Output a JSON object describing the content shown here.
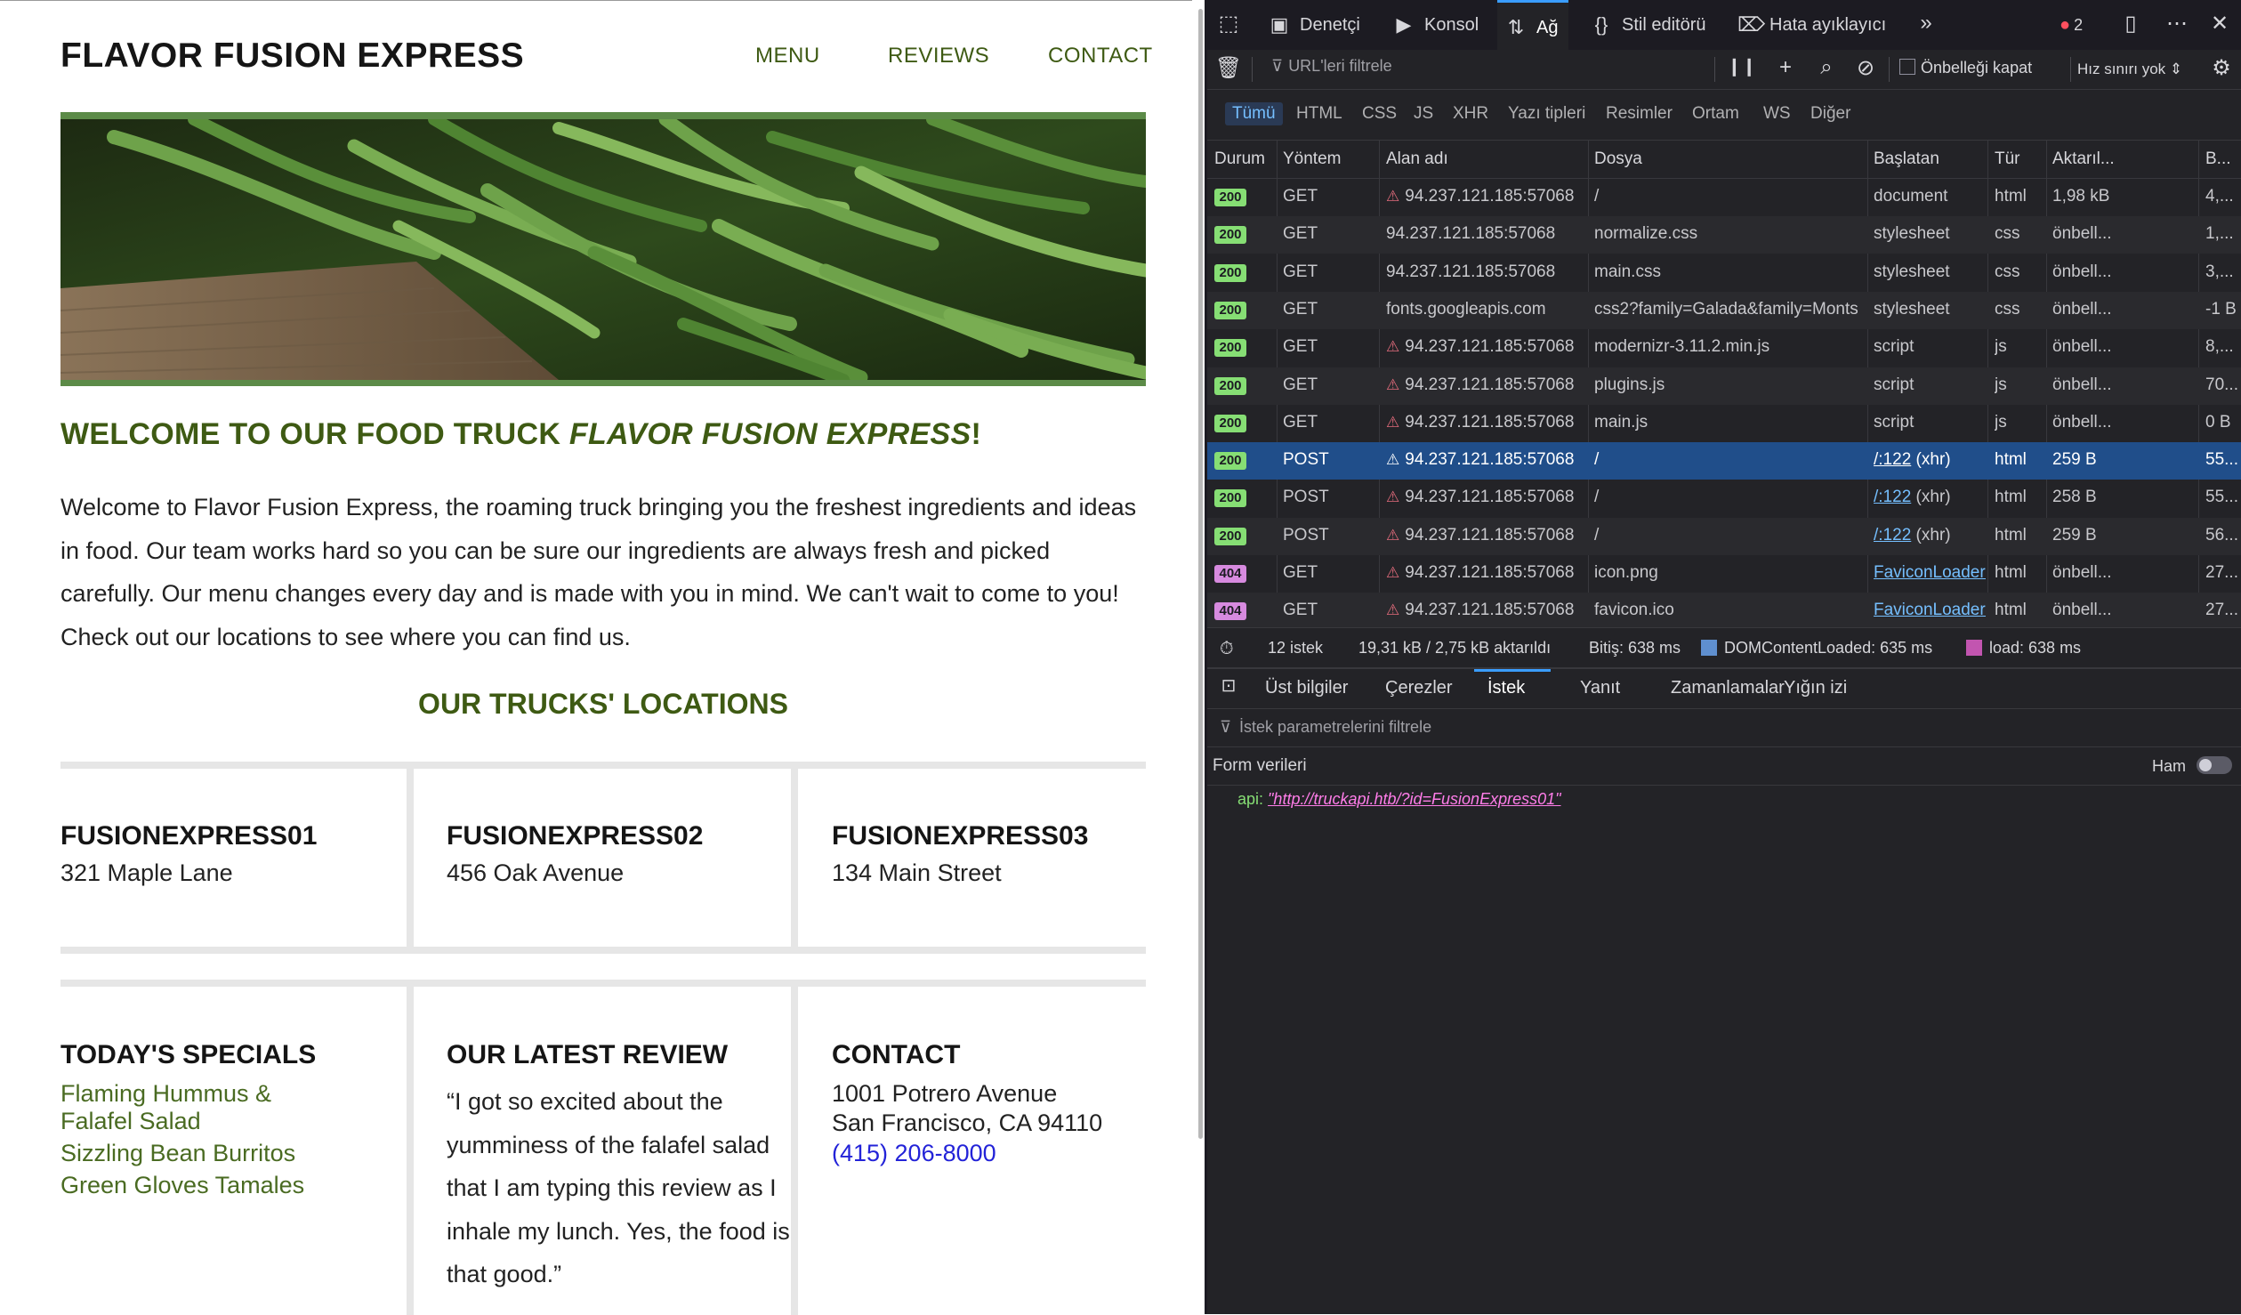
{
  "site": {
    "brand": "FLAVOR FUSION EXPRESS",
    "nav": [
      "MENU",
      "REVIEWS",
      "CONTACT"
    ],
    "hero_alt": "green beans",
    "welcome_prefix": "WELCOME TO OUR FOOD TRUCK ",
    "welcome_em": "FLAVOR FUSION EXPRESS",
    "welcome_suffix": "!",
    "intro": "Welcome to Flavor Fusion Express, the roaming truck bringing you the freshest ingredients and ideas in food. Our team works hard so you can be sure our ingredients are always fresh and picked carefully. Our menu changes every day and is made with you in mind. We can't wait to come to you! Check out our locations to see where you can find us.",
    "locations_title": "OUR TRUCKS' LOCATIONS",
    "trucks": [
      {
        "name": "FUSIONEXPRESS01",
        "address": "321 Maple Lane"
      },
      {
        "name": "FUSIONEXPRESS02",
        "address": "456 Oak Avenue"
      },
      {
        "name": "FUSIONEXPRESS03",
        "address": "134 Main Street"
      }
    ],
    "specials": {
      "title": "TODAY'S SPECIALS",
      "items": [
        "Flaming Hummus &",
        "Falafel Salad",
        "Sizzling Bean Burritos",
        "Green Gloves Tamales"
      ]
    },
    "review": {
      "title": "OUR LATEST REVIEW",
      "text": "“I got so excited about the yumminess of the falafel salad that I am typing this review as I inhale my lunch. Yes, the food is that good.”"
    },
    "contact": {
      "title": "CONTACT",
      "street": "1001 Potrero Avenue",
      "city": "San Francisco, CA 94110",
      "phone": "(415) 206-8000"
    }
  },
  "devtools": {
    "tabs": [
      "Denetçi",
      "Konsol",
      "Ağ",
      "Stil editörü",
      "Hata ayıklayıcı"
    ],
    "active_tab": "Ağ",
    "error_count": "2",
    "filter_placeholder": "URL'leri filtrele",
    "disable_cache": "Önbelleği kapat",
    "throttle": "Hız sınırı yok ⇕",
    "type_filters": [
      "Tümü",
      "HTML",
      "CSS",
      "JS",
      "XHR",
      "Yazı tipleri",
      "Resimler",
      "Ortam",
      "WS",
      "Diğer"
    ],
    "columns": [
      "Durum",
      "Yöntem",
      "Alan adı",
      "Dosya",
      "Başlatan",
      "Tür",
      "Aktarıl...",
      "B..."
    ],
    "requests": [
      {
        "status": "200",
        "method": "GET",
        "domain": "94.237.121.185:57068",
        "lock": true,
        "file": "/",
        "initiator": "document",
        "type": "html",
        "transferred": "1,98 kB",
        "size": "4,..."
      },
      {
        "status": "200",
        "method": "GET",
        "domain": "94.237.121.185:57068",
        "lock": false,
        "file": "normalize.css",
        "initiator": "stylesheet",
        "type": "css",
        "transferred": "önbell...",
        "size": "1,..."
      },
      {
        "status": "200",
        "method": "GET",
        "domain": "94.237.121.185:57068",
        "lock": false,
        "file": "main.css",
        "initiator": "stylesheet",
        "type": "css",
        "transferred": "önbell...",
        "size": "3,..."
      },
      {
        "status": "200",
        "method": "GET",
        "domain": "fonts.googleapis.com",
        "lock": false,
        "file": "css2?family=Galada&family=Monts",
        "initiator": "stylesheet",
        "type": "css",
        "transferred": "önbell...",
        "size": "-1 B"
      },
      {
        "status": "200",
        "method": "GET",
        "domain": "94.237.121.185:57068",
        "lock": true,
        "file": "modernizr-3.11.2.min.js",
        "initiator": "script",
        "type": "js",
        "transferred": "önbell...",
        "size": "8,..."
      },
      {
        "status": "200",
        "method": "GET",
        "domain": "94.237.121.185:57068",
        "lock": true,
        "file": "plugins.js",
        "initiator": "script",
        "type": "js",
        "transferred": "önbell...",
        "size": "70..."
      },
      {
        "status": "200",
        "method": "GET",
        "domain": "94.237.121.185:57068",
        "lock": true,
        "file": "main.js",
        "initiator": "script",
        "type": "js",
        "transferred": "önbell...",
        "size": "0 B"
      },
      {
        "status": "200",
        "method": "POST",
        "domain": "94.237.121.185:57068",
        "lock": true,
        "file": "/",
        "initiator_link": "/:122",
        "initiator": " (xhr)",
        "type": "html",
        "transferred": "259 B",
        "size": "55...",
        "selected": true
      },
      {
        "status": "200",
        "method": "POST",
        "domain": "94.237.121.185:57068",
        "lock": true,
        "file": "/",
        "initiator_link": "/:122",
        "initiator": " (xhr)",
        "type": "html",
        "transferred": "258 B",
        "size": "55..."
      },
      {
        "status": "200",
        "method": "POST",
        "domain": "94.237.121.185:57068",
        "lock": true,
        "file": "/",
        "initiator_link": "/:122",
        "initiator": " (xhr)",
        "type": "html",
        "transferred": "259 B",
        "size": "56..."
      },
      {
        "status": "404",
        "method": "GET",
        "domain": "94.237.121.185:57068",
        "lock": true,
        "file": "icon.png",
        "initiator_link": "FaviconLoader.sys....",
        "initiator": "",
        "type": "html",
        "transferred": "önbell...",
        "size": "27..."
      },
      {
        "status": "404",
        "method": "GET",
        "domain": "94.237.121.185:57068",
        "lock": true,
        "file": "favicon.ico",
        "initiator_link": "FaviconLoader.sys....",
        "initiator": "",
        "type": "html",
        "transferred": "önbell...",
        "size": "27..."
      }
    ],
    "summary": {
      "requests": "12 istek",
      "size": "19,31 kB / 2,75 kB aktarıldı",
      "finish": "Bitiş: 638 ms",
      "dom": "DOMContentLoaded: 635 ms",
      "load": "load: 638 ms"
    },
    "detail_tabs": [
      "Üst bilgiler",
      "Çerezler",
      "İstek",
      "Yanıt",
      "Zamanlamalar",
      "Yığın izi"
    ],
    "detail_active": "İstek",
    "param_filter": "İstek parametrelerini filtrele",
    "form_label": "Form verileri",
    "raw_label": "Ham",
    "param": {
      "key": "api:",
      "value": "\"http://truckapi.htb/?id=FusionExpress01\""
    }
  }
}
